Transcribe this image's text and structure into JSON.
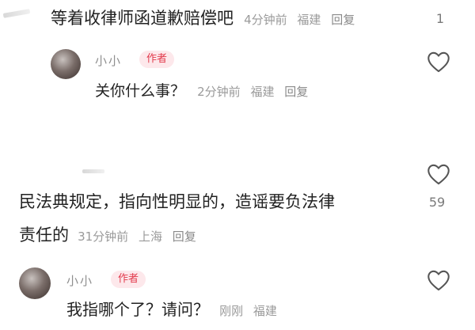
{
  "comments": [
    {
      "text": "等着收律师函道歉赔偿吧",
      "time": "4分钟前",
      "location": "福建",
      "reply_label": "回复",
      "like_count": "1"
    },
    {
      "username": "小小",
      "badge": "作者",
      "text": "关你什么事？",
      "time": "2分钟前",
      "location": "福建",
      "reply_label": "回复"
    },
    {
      "text_line1": "民法典规定，指向性明显的，造谣要负法律",
      "text_line2": "责任的",
      "time": "31分钟前",
      "location": "上海",
      "reply_label": "回复",
      "like_count": "59"
    },
    {
      "username": "小小",
      "badge": "作者",
      "text": "我指哪个了？请问？",
      "time": "刚刚",
      "location": "福建"
    }
  ],
  "icons": {
    "like": "heart-outline-icon"
  },
  "colors": {
    "badge_text": "#e23a4c",
    "badge_bg": "#fde8eb",
    "meta": "#9a9a9a"
  }
}
